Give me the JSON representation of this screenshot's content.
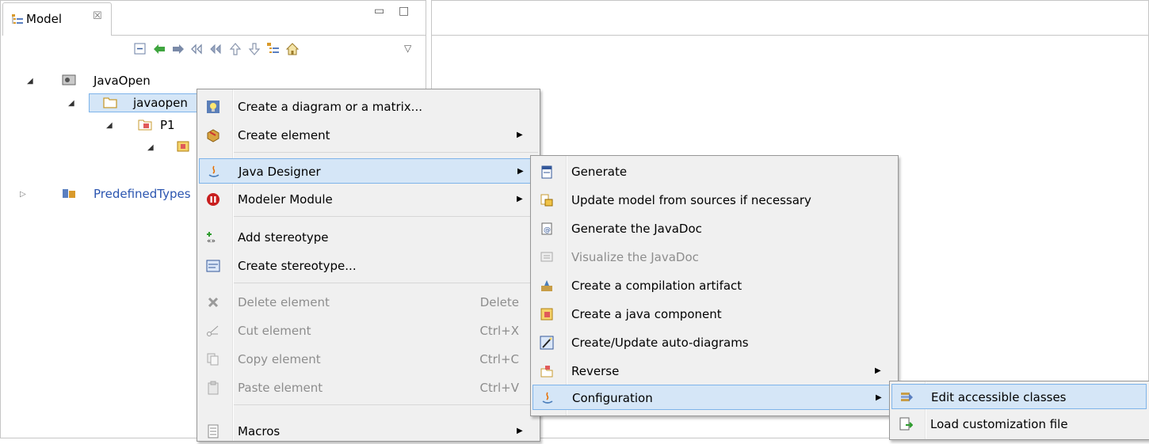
{
  "view": {
    "tab_title": "Model",
    "tab_close": "☒",
    "minimize": "▭",
    "maximize": "□",
    "view_menu": "▽"
  },
  "toolbar": [
    "collapse-all-icon",
    "back-icon",
    "forward-icon",
    "previous-icon",
    "next-icon",
    "up-icon",
    "down-icon",
    "model-tree-icon",
    "home-icon"
  ],
  "tree": {
    "root": "JavaOpen",
    "package": "javaopen",
    "child": "P1",
    "predefined": "PredefinedTypes"
  },
  "context_menu": {
    "items": [
      {
        "label": "Create a diagram or a matrix...",
        "icon": "lightbulb-icon"
      },
      {
        "label": "Create element",
        "icon": "package-box-icon",
        "submenu": true
      },
      {
        "label": "Java Designer",
        "icon": "java-icon",
        "submenu": true,
        "highlighted": true
      },
      {
        "label": "Modeler Module",
        "icon": "modeler-module-icon",
        "submenu": true
      },
      {
        "label": "Add stereotype",
        "icon": "add-stereotype-icon"
      },
      {
        "label": "Create stereotype...",
        "icon": "create-stereotype-icon"
      },
      {
        "label": "Delete element",
        "shortcut": "Delete",
        "icon": "delete-icon",
        "disabled": true
      },
      {
        "label": "Cut element",
        "shortcut": "Ctrl+X",
        "icon": "cut-icon",
        "disabled": true
      },
      {
        "label": "Copy element",
        "shortcut": "Ctrl+C",
        "icon": "copy-icon",
        "disabled": true
      },
      {
        "label": "Paste element",
        "shortcut": "Ctrl+V",
        "icon": "paste-icon",
        "disabled": true
      },
      {
        "label": "Macros",
        "icon": "macros-icon",
        "submenu": true
      }
    ]
  },
  "java_menu": {
    "items": [
      {
        "label": "Generate",
        "icon": "generate-icon"
      },
      {
        "label": "Update model from sources if necessary",
        "icon": "update-model-icon"
      },
      {
        "label": "Generate the JavaDoc",
        "icon": "javadoc-icon"
      },
      {
        "label": "Visualize the JavaDoc",
        "icon": "visualize-javadoc-icon",
        "disabled": true
      },
      {
        "label": "Create a compilation artifact",
        "icon": "artifact-icon"
      },
      {
        "label": "Create a java component",
        "icon": "component-icon"
      },
      {
        "label": "Create/Update auto-diagrams",
        "icon": "auto-diagram-icon"
      },
      {
        "label": "Reverse",
        "icon": "reverse-icon",
        "submenu": true
      },
      {
        "label": "Configuration",
        "icon": "configuration-icon",
        "submenu": true,
        "highlighted": true
      }
    ]
  },
  "config_menu": {
    "items": [
      {
        "label": "Edit accessible classes",
        "icon": "edit-classes-icon",
        "highlighted": true
      },
      {
        "label": "Load customization file",
        "icon": "load-file-icon"
      }
    ]
  },
  "colors": {
    "highlight": "#d5e6f7",
    "highlight_border": "#7eb4ea",
    "link_blue": "#2b55b0"
  }
}
